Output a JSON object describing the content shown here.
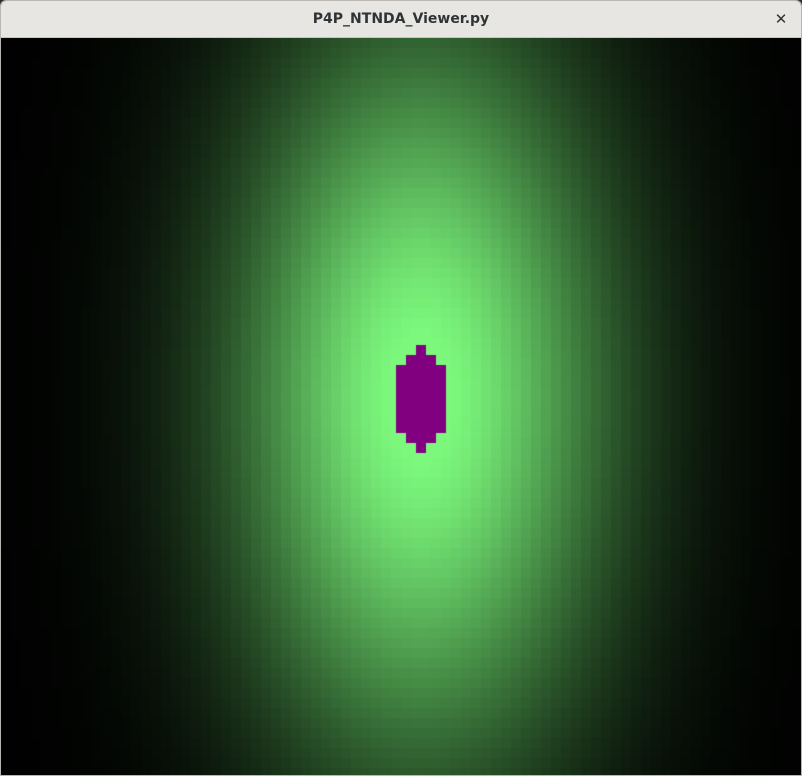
{
  "window": {
    "title": "P4P_NTNDA_Viewer.py",
    "close_glyph": "✕"
  },
  "image_view": {
    "colormap_base": "#000000",
    "colormap_peak": "#7cf87c",
    "saturation_color": "#800080"
  }
}
